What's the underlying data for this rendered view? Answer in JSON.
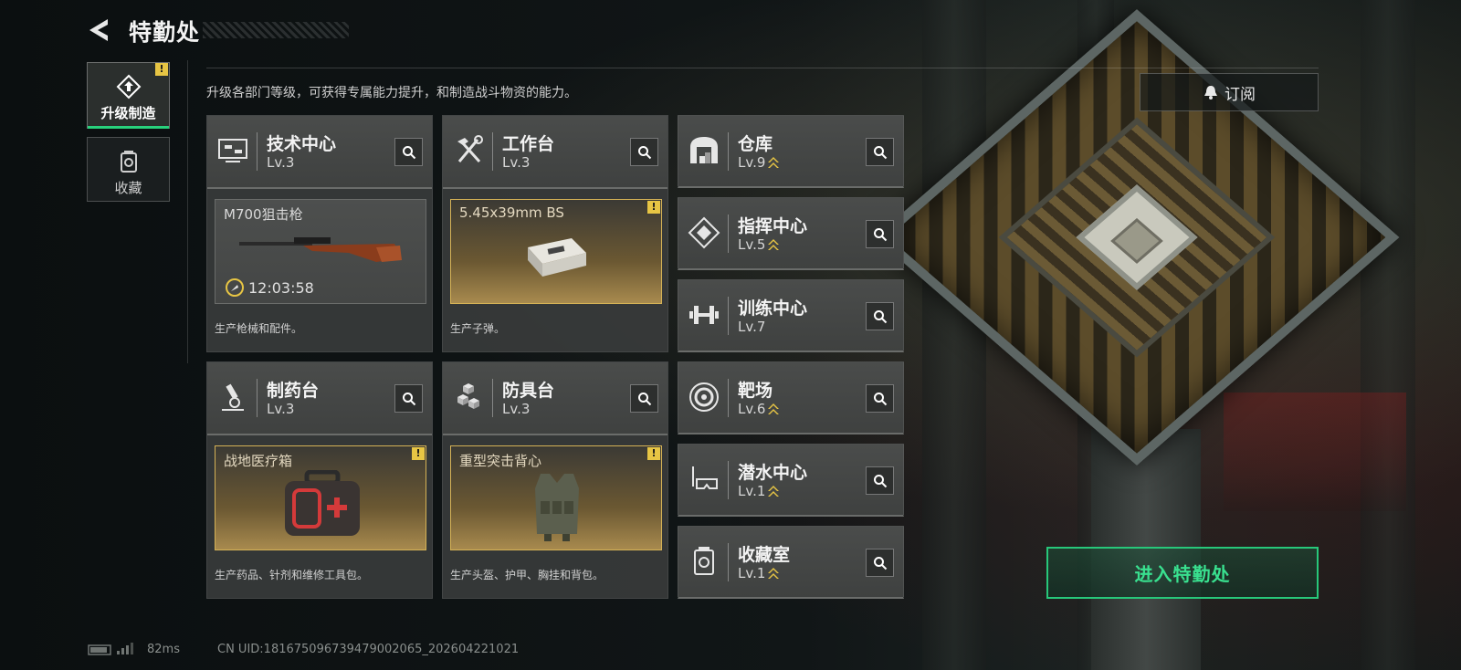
{
  "header": {
    "title": "特勤处",
    "subtitle": "升级各部门等级，可获得专属能力提升，和制造战斗物资的能力。"
  },
  "nav": {
    "upgrade_label": "升级制造",
    "collect_label": "收藏",
    "upgrade_alert": "!"
  },
  "subscribe_label": "订阅",
  "enter_label": "进入特勤处",
  "departments": {
    "tech": {
      "name": "技术中心",
      "level": "Lv.3",
      "product": "M700狙击枪",
      "timer": "12:03:58",
      "desc": "生产枪械和配件。"
    },
    "workbench": {
      "name": "工作台",
      "level": "Lv.3",
      "product": "5.45x39mm BS",
      "desc": "生产子弹。",
      "alert": "!"
    },
    "pharma": {
      "name": "制药台",
      "level": "Lv.3",
      "product": "战地医疗箱",
      "desc": "生产药品、针剂和维修工具包。",
      "alert": "!"
    },
    "armor": {
      "name": "防具台",
      "level": "Lv.3",
      "product": "重型突击背心",
      "desc": "生产头盔、护甲、胸挂和背包。",
      "alert": "!"
    },
    "warehouse": {
      "name": "仓库",
      "level": "Lv.9"
    },
    "command": {
      "name": "指挥中心",
      "level": "Lv.5"
    },
    "training": {
      "name": "训练中心",
      "level": "Lv.7"
    },
    "range": {
      "name": "靶场",
      "level": "Lv.6"
    },
    "diving": {
      "name": "潜水中心",
      "level": "Lv.1"
    },
    "collection": {
      "name": "收藏室",
      "level": "Lv.1"
    }
  },
  "footer": {
    "ping": "82ms",
    "uid": "CN UID:181675096739479002065_202604221021"
  },
  "colors": {
    "accent_green": "#28d17c",
    "alert_yellow": "#e7c544",
    "gold_border": "#d5b256"
  }
}
